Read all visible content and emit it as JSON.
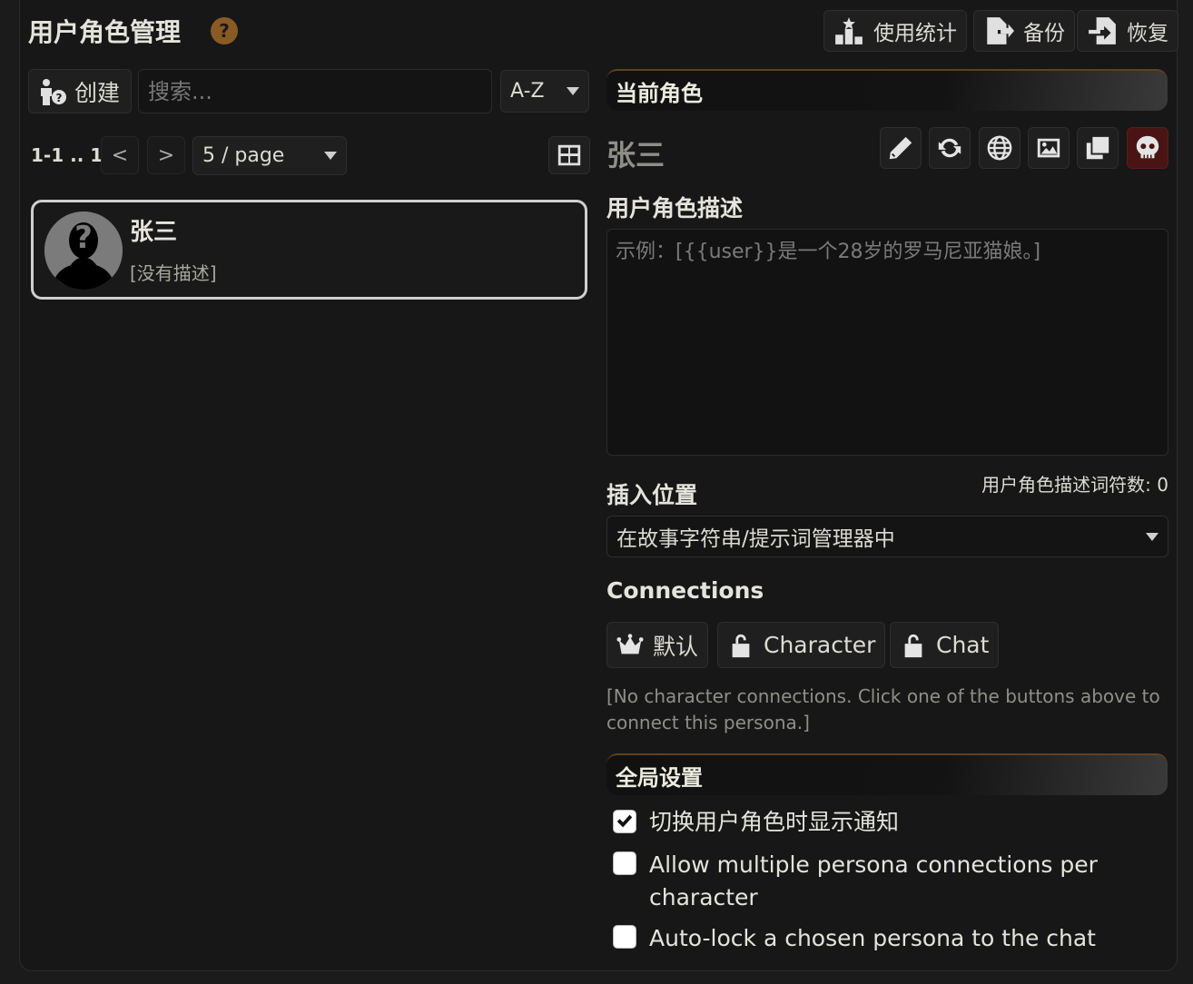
{
  "header": {
    "title": "用户角色管理",
    "help": "?",
    "stats_label": "使用统计",
    "backup_label": "备份",
    "restore_label": "恢复"
  },
  "list": {
    "create_label": "创建",
    "search_placeholder": "搜索...",
    "sort_value": "A-Z",
    "page_info": "1-1 .. 1",
    "prev": "<",
    "next": ">",
    "page_size": "5 / page",
    "items": [
      {
        "name": "张三",
        "description": "[没有描述]"
      }
    ]
  },
  "current": {
    "header": "当前角色",
    "name": "张三",
    "description_label": "用户角色描述",
    "description_placeholder": "示例：[{{user}}是一个28岁的罗马尼亚猫娘。]",
    "description_value": "",
    "token_count_label": "用户角色描述词符数: 0",
    "position_label": "插入位置",
    "position_value": "在故事字符串/提示词管理器中",
    "connections_label": "Connections",
    "connections": {
      "default_label": "默认",
      "character_label": "Character",
      "chat_label": "Chat"
    },
    "connections_note": "[No character connections. Click one of the buttons above to connect this persona.]"
  },
  "global": {
    "header": "全局设置",
    "options": [
      {
        "label": "切换用户角色时显示通知",
        "checked": true
      },
      {
        "label": "Allow multiple persona connections per character",
        "checked": false
      },
      {
        "label": "Auto-lock a chosen persona to the chat",
        "checked": false
      }
    ]
  }
}
